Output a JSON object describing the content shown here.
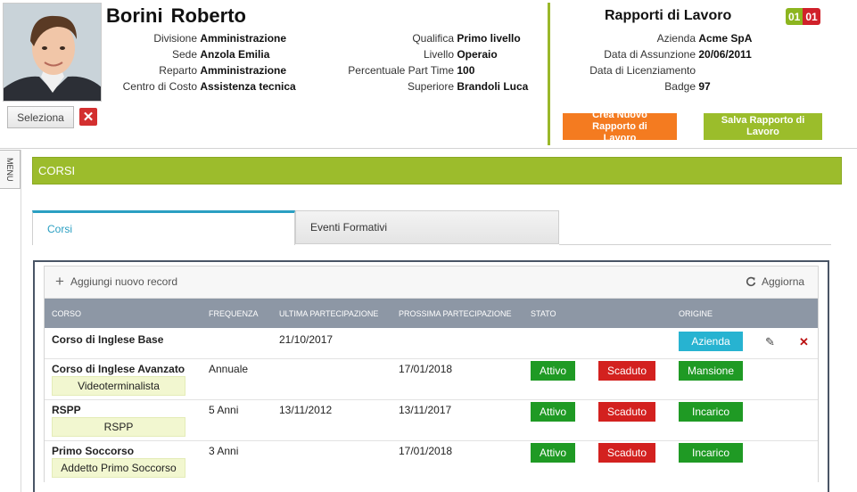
{
  "employee": {
    "name": "Borini  Roberto",
    "select_label": "Seleziona",
    "left_fields": [
      {
        "label": "Divisione",
        "value": "Amministrazione"
      },
      {
        "label": "Sede",
        "value": "Anzola Emilia"
      },
      {
        "label": "Reparto",
        "value": "Amministrazione"
      },
      {
        "label": "Centro di Costo",
        "value": "Assistenza tecnica"
      }
    ],
    "mid_fields": [
      {
        "label": "Qualifica",
        "value": "Primo livello"
      },
      {
        "label": "Livello",
        "value": "Operaio"
      },
      {
        "label": "Percentuale Part Time",
        "value": "100"
      },
      {
        "label": "Superiore",
        "value": "Brandoli Luca"
      }
    ]
  },
  "rapporti": {
    "title": "Rapporti di Lavoro",
    "badge_a": "01",
    "badge_b": "01",
    "fields": [
      {
        "label": "Azienda",
        "value": "Acme SpA"
      },
      {
        "label": "Data di Assunzione",
        "value": "20/06/2011"
      },
      {
        "label": "Data di Licenziamento",
        "value": ""
      },
      {
        "label": "Badge",
        "value": "97"
      }
    ],
    "new_button": "Crea Nuovo Rapporto di Lavoro",
    "save_button": "Salva Rapporto di Lavoro"
  },
  "menu_label": "MENU",
  "section_title": "CORSI",
  "tabs": [
    {
      "label": "Corsi",
      "active": true
    },
    {
      "label": "Eventi Formativi",
      "active": false
    }
  ],
  "grid": {
    "add_label": "Aggiungi nuovo record",
    "refresh_label": "Aggiorna",
    "columns": [
      "CORSO",
      "FREQUENZA",
      "ULTIMA PARTECIPAZIONE",
      "PROSSIMA PARTECIPAZIONE",
      "STATO",
      "ORIGINE"
    ],
    "rows": [
      {
        "corso": "Corso di Inglese Base",
        "tag": "",
        "frequenza": "",
        "ultima": "21/10/2017",
        "prossima": "",
        "stato": "",
        "scadenza": "",
        "origine": "Azienda"
      },
      {
        "corso": "Corso di Inglese Avanzato",
        "tag": "Videoterminalista",
        "frequenza": "Annuale",
        "ultima": "",
        "prossima": "17/01/2018",
        "stato": "Attivo",
        "scadenza": "Scaduto",
        "origine": "Mansione"
      },
      {
        "corso": "RSPP",
        "tag": "RSPP",
        "frequenza": "5 Anni",
        "ultima": "13/11/2012",
        "prossima": "13/11/2017",
        "stato": "Attivo",
        "scadenza": "Scaduto",
        "origine": "Incarico"
      },
      {
        "corso": "Primo Soccorso",
        "tag": "Addetto Primo Soccorso",
        "frequenza": "3 Anni",
        "ultima": "",
        "prossima": "17/01/2018",
        "stato": "Attivo",
        "scadenza": "Scaduto",
        "origine": "Incarico"
      }
    ]
  },
  "colors": {
    "accent_green": "#9cbc2c",
    "orange": "#f47b20",
    "active_tab": "#2a9fc2",
    "status_green": "#1f9a24",
    "status_red": "#d3211f"
  },
  "icons": [
    "close-icon",
    "plus-icon",
    "refresh-icon",
    "pencil-icon",
    "delete-icon"
  ]
}
